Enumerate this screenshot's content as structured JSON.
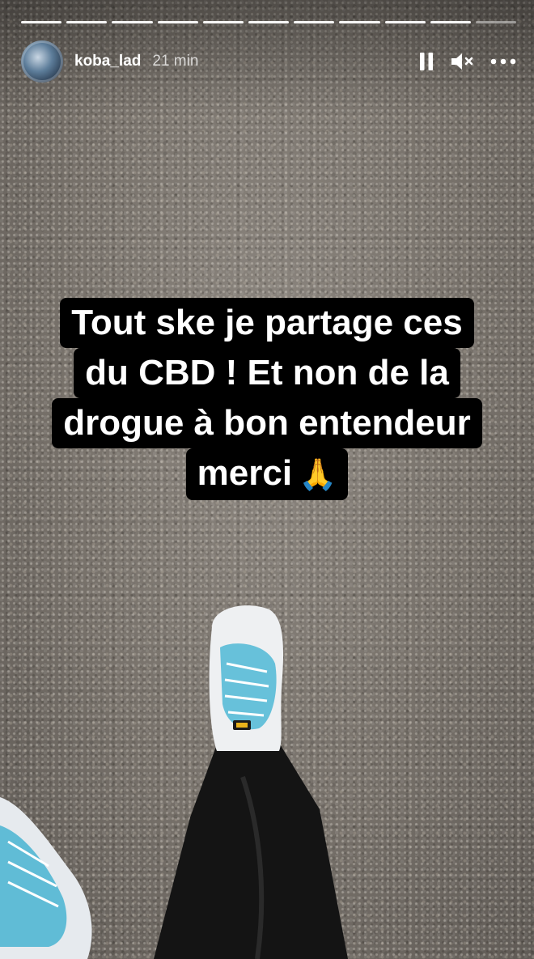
{
  "story": {
    "segments_total": 11,
    "segments_viewed": 10,
    "username": "koba_lad",
    "timestamp": "21 min",
    "icons": [
      "avatar",
      "pause-icon",
      "mute-icon",
      "more-icon",
      "praying-hands-icon"
    ],
    "caption_lines": [
      "Tout ske je partage ces",
      "du CBD ! Et non de la",
      "drogue à bon entendeur",
      "merci"
    ],
    "caption_emoji": "🙏"
  }
}
